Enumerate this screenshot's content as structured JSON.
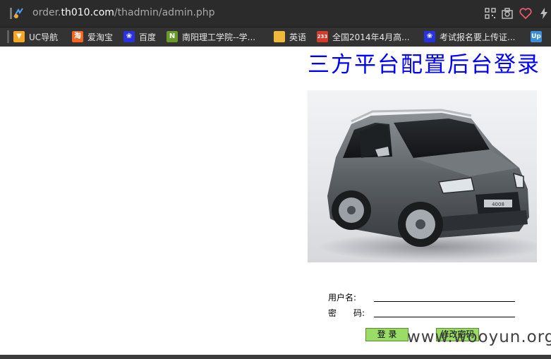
{
  "browser": {
    "url_prefix": "order.",
    "url_host": "th010.com",
    "url_path": "/thadmin/admin.php"
  },
  "bookmarks": [
    {
      "label": "UC导航",
      "icon": "uc-nav-icon",
      "color": "#f5a623",
      "glyph": "▼"
    },
    {
      "label": "爱淘宝",
      "icon": "taobao-icon",
      "color": "#f26522",
      "glyph": "淘"
    },
    {
      "label": "百度",
      "icon": "baidu-paw-icon",
      "color": "#2932e1",
      "glyph": "❀"
    },
    {
      "label": "南阳理工学院--学...",
      "icon": "nyist-icon",
      "color": "#6a9a2a",
      "glyph": "N"
    },
    {
      "label": "英语",
      "icon": "folder-icon",
      "color": "#f0b93a",
      "glyph": ""
    },
    {
      "label": "全国2014年4月高...",
      "icon": "site-233-icon",
      "color": "#d63a2a",
      "glyph": "233"
    },
    {
      "label": "考试报名要上传证...",
      "icon": "baidu-paw-icon",
      "color": "#2932e1",
      "glyph": "❀"
    },
    {
      "label": "",
      "icon": "up-icon",
      "color": "#3a8fd8",
      "glyph": "Up"
    }
  ],
  "page": {
    "title": "三方平台配置后台登录",
    "image_alt": "car-photo"
  },
  "form": {
    "username_label": "用户名:",
    "password_label": "密　　码:",
    "username_value": "",
    "password_value": ""
  },
  "buttons": {
    "login": "登 录",
    "change_password": "修改密码"
  },
  "watermark": "www.wooyun.org"
}
